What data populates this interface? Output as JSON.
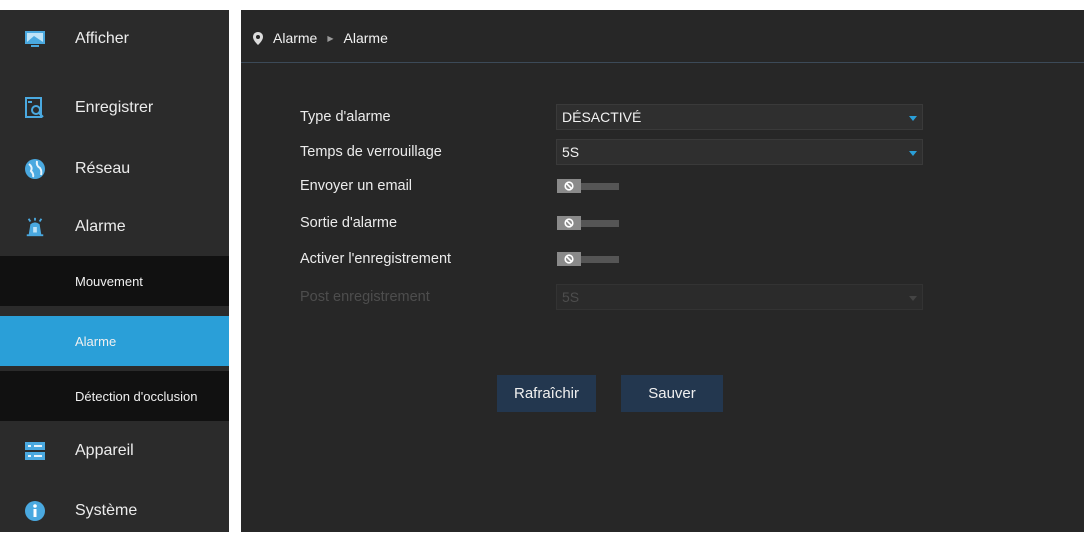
{
  "sidebar": {
    "items": [
      {
        "label": "Afficher",
        "icon": "monitor-icon"
      },
      {
        "label": "Enregistrer",
        "icon": "search-record-icon"
      },
      {
        "label": "Réseau",
        "icon": "network-globe-icon"
      },
      {
        "label": "Alarme",
        "icon": "alarm-siren-icon"
      },
      {
        "label": "Appareil",
        "icon": "device-storage-icon"
      },
      {
        "label": "Système",
        "icon": "info-icon"
      }
    ],
    "subitems": [
      {
        "label": "Mouvement"
      },
      {
        "label": "Alarme",
        "active": true
      },
      {
        "label": "Détection d'occlusion"
      }
    ]
  },
  "breadcrumb": {
    "icon": "location-pin-icon",
    "items": [
      "Alarme",
      "Alarme"
    ]
  },
  "form": {
    "alarm_type": {
      "label": "Type d'alarme",
      "value": "DÉSACTIVÉ"
    },
    "lock_time": {
      "label": "Temps de verrouillage",
      "value": "5S"
    },
    "send_email": {
      "label": "Envoyer un email",
      "state": "off"
    },
    "alarm_output": {
      "label": "Sortie d'alarme",
      "state": "off"
    },
    "enable_record": {
      "label": "Activer l'enregistrement",
      "state": "off"
    },
    "post_record": {
      "label": "Post enregistrement",
      "value": "5S",
      "disabled": true
    }
  },
  "buttons": {
    "refresh": "Rafraîchir",
    "save": "Sauver"
  },
  "colors": {
    "accent": "#2a9fd8",
    "button": "#23374f",
    "sidebar_bg": "#2b2b2b",
    "main_bg": "#272727"
  }
}
